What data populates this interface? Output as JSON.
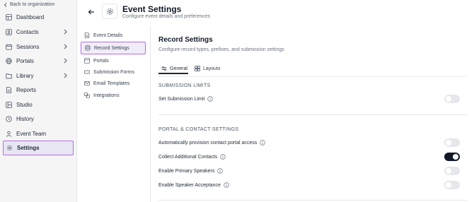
{
  "sidebar": {
    "back_label": "Back to organization",
    "items": [
      {
        "label": "Dashboard",
        "icon": "dashboard-icon"
      },
      {
        "label": "Contacts",
        "icon": "contacts-icon"
      },
      {
        "label": "Sessions",
        "icon": "sessions-icon"
      },
      {
        "label": "Portals",
        "icon": "portals-icon"
      },
      {
        "label": "Library",
        "icon": "library-icon"
      },
      {
        "label": "Reports",
        "icon": "reports-icon"
      },
      {
        "label": "Studio",
        "icon": "studio-icon"
      },
      {
        "label": "History",
        "icon": "history-icon"
      },
      {
        "label": "Event Team",
        "icon": "event-team-icon"
      },
      {
        "label": "Settings",
        "icon": "gear-icon"
      }
    ]
  },
  "header": {
    "title": "Event Settings",
    "subtitle": "Configure event details and preferences"
  },
  "subnav": {
    "items": [
      {
        "label": "Event Details"
      },
      {
        "label": "Record Settings"
      },
      {
        "label": "Portals"
      },
      {
        "label": "Submission Forms"
      },
      {
        "label": "Email Templates"
      },
      {
        "label": "Integrations"
      }
    ]
  },
  "main": {
    "title": "Record Settings",
    "subtitle": "Configure record types, prefixes, and submission settings",
    "tabs": [
      {
        "label": "General"
      },
      {
        "label": "Layouts"
      }
    ],
    "sections": {
      "submission": {
        "title": "SUBMISSION LIMITS",
        "rows": [
          {
            "label": "Set Submission Limit",
            "on": false
          }
        ]
      },
      "portal": {
        "title": "PORTAL & CONTACT SETTINGS",
        "rows": [
          {
            "label": "Automatically provision contact portal access",
            "on": false
          },
          {
            "label": "Collect Additional Contacts",
            "on": true
          },
          {
            "label": "Enable Primary Speakers",
            "on": false
          },
          {
            "label": "Enable Speaker Acceptance",
            "on": false
          }
        ]
      }
    }
  },
  "colors": {
    "highlight_border": "#b36ee0",
    "toggle_on": "#111827",
    "toggle_off": "#e5e7eb"
  }
}
